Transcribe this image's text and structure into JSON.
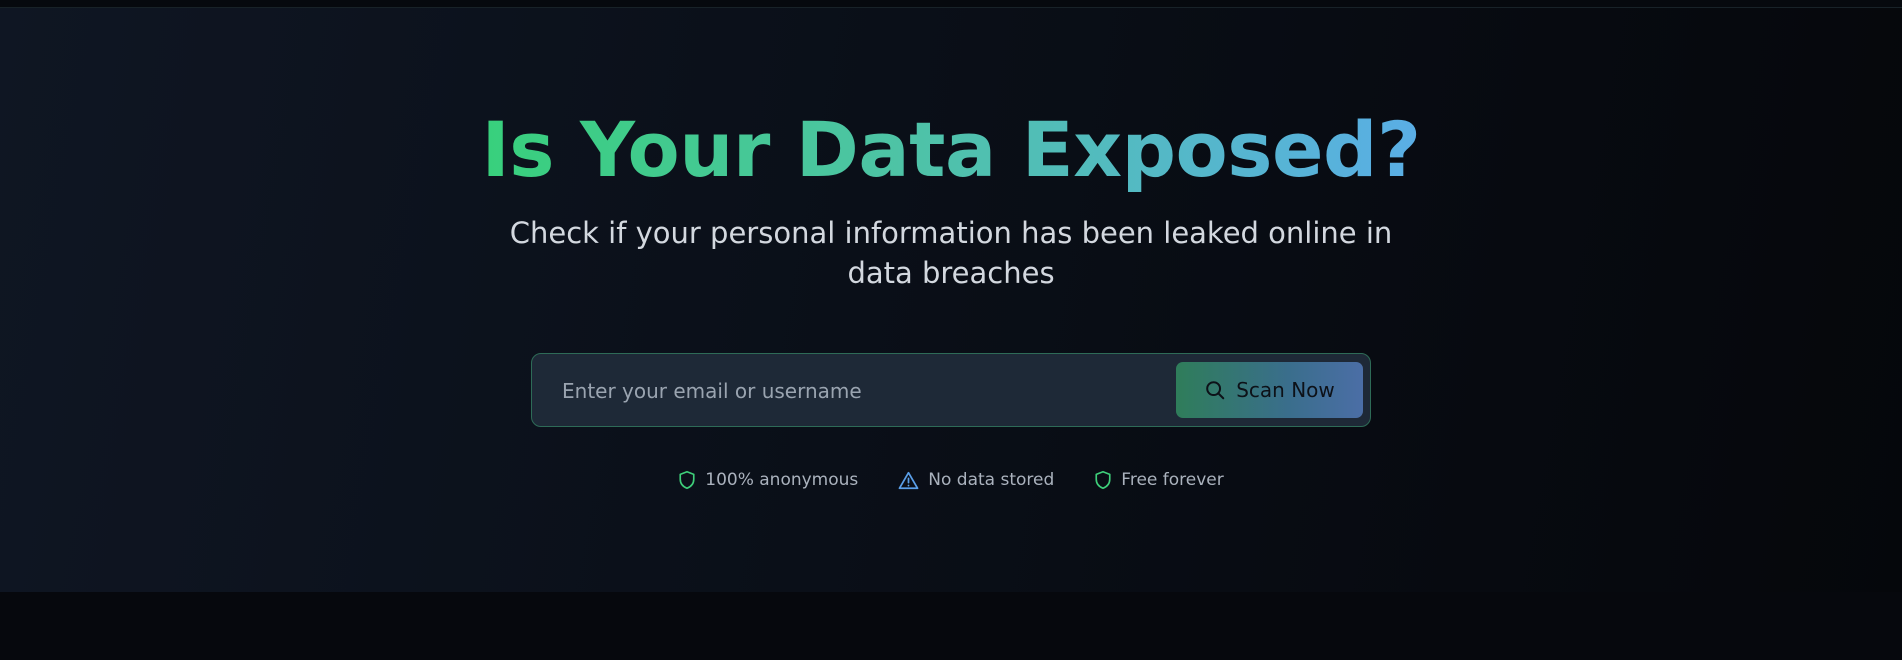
{
  "hero": {
    "title": "Is Your Data Exposed?",
    "subtitle": "Check if your personal information has been leaked online in data breaches"
  },
  "search": {
    "placeholder": "Enter your email or username",
    "value": "",
    "button_label": "Scan Now",
    "button_icon": "search-icon"
  },
  "features": [
    {
      "label": "100% anonymous",
      "icon": "shield-icon",
      "color": "#3ecf7a"
    },
    {
      "label": "No data stored",
      "icon": "warning-icon",
      "color": "#5a9ee8"
    },
    {
      "label": "Free forever",
      "icon": "shield-icon",
      "color": "#3ecf7a"
    }
  ],
  "colors": {
    "title_gradient_start": "#38d07c",
    "title_gradient_end": "#5aaee6",
    "input_border": "#2e6b57",
    "button_gradient_start": "#2f7d5a",
    "button_gradient_end": "#4b6ea6"
  }
}
